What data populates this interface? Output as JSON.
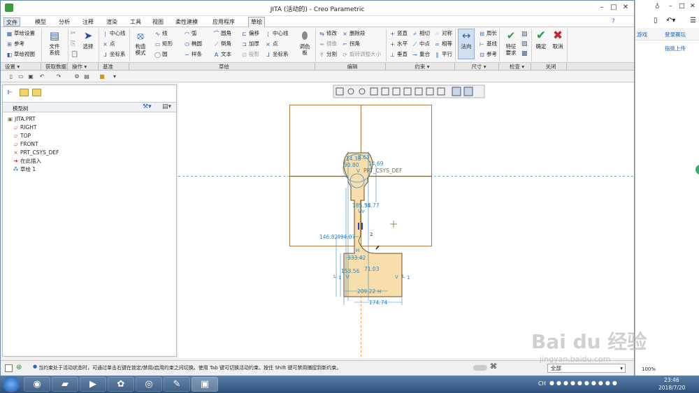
{
  "window": {
    "title": "JITA (活动的) - Creo Parametric"
  },
  "tabs": [
    {
      "label": "文件"
    },
    {
      "label": "模型"
    },
    {
      "label": "分析"
    },
    {
      "label": "注释"
    },
    {
      "label": "渲染"
    },
    {
      "label": "工具"
    },
    {
      "label": "视图"
    },
    {
      "label": "柔性建模"
    },
    {
      "label": "应用程序"
    },
    {
      "label": "草绘"
    }
  ],
  "ribbon": {
    "setup": {
      "sketch_setup": "草绘设置",
      "reference": "参考",
      "sketch_view": "草绘视图",
      "group": "设置"
    },
    "get_data": {
      "file_system": "文件\n系统",
      "group": "获取数据"
    },
    "operations": {
      "select": "选择",
      "group": "操作"
    },
    "datum": {
      "centerline": "中心线",
      "point": "点",
      "csys": "坐标系",
      "group": "基准"
    },
    "sketch": {
      "construction": "构造\n模式",
      "line": "线",
      "arc": "弧",
      "fillet": "圆角",
      "offset": "偏移",
      "centerline": "中心线",
      "rectangle": "矩形",
      "ellipse": "椭圆",
      "chamfer": "倒角",
      "thicken": "加厚",
      "point": "点",
      "circle": "圆",
      "spline": "样条",
      "text": "文本",
      "project": "投影",
      "csys": "坐标系",
      "palette": "调色\n板",
      "group": "草绘"
    },
    "edit": {
      "modify": "修改",
      "delete_segment": "删除段",
      "mirror": "镜像",
      "divide": "拐角",
      "split": "分割",
      "rotate_resize": "旋转调整大小",
      "group": "编辑"
    },
    "constrain": {
      "vertical": "竖直",
      "tangent": "相切",
      "symmetric": "对称",
      "horizontal": "水平",
      "midpoint": "中点",
      "equal": "相等",
      "perpendicular": "垂直",
      "coincident": "重合",
      "parallel": "平行",
      "group": "约束"
    },
    "dimension": {
      "normal": "法向",
      "perimeter": "周长",
      "baseline": "基线",
      "reference": "参考",
      "group": "尺寸"
    },
    "inspect": {
      "feature_req": "特征\n要求",
      "group": "检查"
    },
    "close": {
      "ok": "确定",
      "cancel": "取消",
      "group": "关闭"
    }
  },
  "model_tree": {
    "title": "模型树",
    "items": [
      {
        "label": "JITA.PRT",
        "icon": "part-icon"
      },
      {
        "label": "RIGHT",
        "icon": "datum-plane-icon"
      },
      {
        "label": "TOP",
        "icon": "datum-plane-icon"
      },
      {
        "label": "FRONT",
        "icon": "datum-plane-icon"
      },
      {
        "label": "PRT_CSYS_DEF",
        "icon": "csys-icon"
      },
      {
        "label": "在此插入",
        "icon": "insert-arrow-icon"
      },
      {
        "label": "草绘 1",
        "icon": "sketch-icon"
      }
    ]
  },
  "canvas": {
    "csys_label": "PRT_CSYS_DEF",
    "dims": [
      "14.38",
      "8.63",
      "14.69",
      "90.80",
      "185.38",
      "54.77",
      "146.82",
      "494.07",
      "333.42",
      "153.56",
      "71.03",
      "209.22",
      "174.74"
    ],
    "constraint_marks": [
      "V",
      "V",
      "V",
      "V",
      "V",
      "L",
      "1",
      "L",
      "1",
      "H",
      "H",
      "2"
    ]
  },
  "status": {
    "message": "当约束处于活动状态时，可通过单击右键在锁定/禁用/启用约束之间切换。使用 Tab 键可切换活动约束。按住 Shift 键可禁用捕捉到新约束。",
    "filter": "全部"
  },
  "browser": {
    "game": "游戏",
    "login": "登录赛坛",
    "link": "指挑上传"
  },
  "taskbar": {
    "lang": "CH",
    "time": "23:46",
    "date": "2018/7/20",
    "zoom": "100%"
  },
  "watermark": {
    "text": "Bai du 经验",
    "url": "jingyan.baidu.com"
  },
  "colors": {
    "sketch_fill": "#f7deab",
    "dim_blue": "#2b87c7",
    "accent": "#2a62b0"
  }
}
